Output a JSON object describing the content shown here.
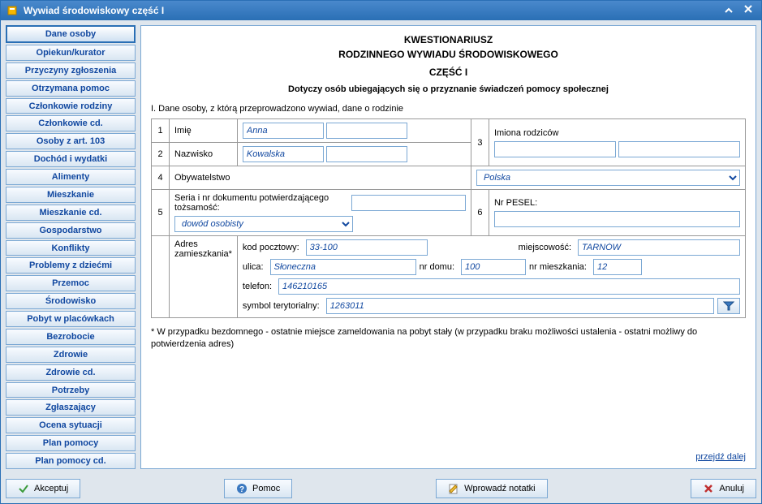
{
  "window": {
    "title": "Wywiad środowiskowy część I"
  },
  "sidebar": {
    "items": [
      "Dane osoby",
      "Opiekun/kurator",
      "Przyczyny zgłoszenia",
      "Otrzymana pomoc",
      "Członkowie rodziny",
      "Członkowie cd.",
      "Osoby z art. 103",
      "Dochód i wydatki",
      "Alimenty",
      "Mieszkanie",
      "Mieszkanie cd.",
      "Gospodarstwo",
      "Konflikty",
      "Problemy z dziećmi",
      "Przemoc",
      "Środowisko",
      "Pobyt w placówkach",
      "Bezrobocie",
      "Zdrowie",
      "Zdrowie cd.",
      "Potrzeby",
      "Zgłaszający",
      "Ocena sytuacji",
      "Plan pomocy",
      "Plan pomocy cd."
    ],
    "selectedIndex": 0
  },
  "header": {
    "l1": "KWESTIONARIUSZ",
    "l2": "RODZINNEGO WYWIADU ŚRODOWISKOWEGO",
    "l3": "CZĘŚĆ I",
    "l4": "Dotyczy osób ubiegających się o przyznanie świadczeń pomocy społecznej"
  },
  "section1_label": "I. Dane osoby, z którą przeprowadzono wywiad, dane o rodzinie",
  "labels": {
    "n1": "1",
    "imie": "Imię",
    "n2": "2",
    "nazwisko": "Nazwisko",
    "n3": "3",
    "imiona_rodzicow": "Imiona rodziców",
    "n4": "4",
    "obywatelstwo": "Obywatelstwo",
    "n5": "5",
    "dokument": "Seria i nr dokumentu potwierdzającego tożsamość:",
    "n6": "6",
    "pesel": "Nr PESEL:",
    "adres_hdr": "Adres zamieszkania*",
    "kod": "kod pocztowy:",
    "miejscowosc": "miejscowość:",
    "ulica": "ulica:",
    "nrdomu": "nr domu:",
    "nrmieszk": "nr mieszkania:",
    "telefon": "telefon:",
    "symbol": "symbol terytorialny:"
  },
  "values": {
    "imie1": "Anna",
    "imie2": "",
    "nazwisko1": "Kowalska",
    "nazwisko2": "",
    "rodzic1": "",
    "rodzic2": "",
    "obywatelstwo": "Polska",
    "dok_nr": "",
    "dok_typ": "dowód osobisty",
    "pesel": "",
    "kod": "33-100",
    "miejscowosc": "TARNÓW",
    "ulica": "Słoneczna",
    "nrdomu": "100",
    "nrmieszk": "12",
    "telefon": "146210165",
    "symbol": "1263011"
  },
  "footnote": "* W przypadku bezdomnego - ostatnie miejsce zameldowania na pobyt stały (w przypadku braku możliwości ustalenia - ostatni możliwy do potwierdzenia adres)",
  "next_link": "przejdź dalej",
  "buttons": {
    "accept": "Akceptuj",
    "help": "Pomoc",
    "notes": "Wprowadź notatki",
    "cancel": "Anuluj"
  }
}
